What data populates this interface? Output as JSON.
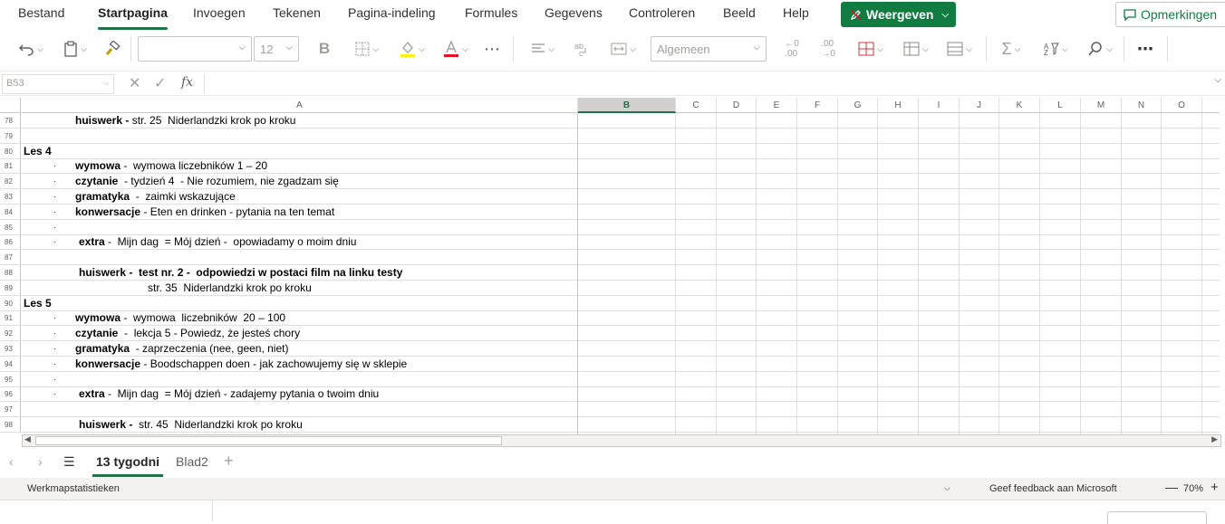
{
  "ribbon": {
    "tabs": [
      "Bestand",
      "Startpagina",
      "Invoegen",
      "Tekenen",
      "Pagina-indeling",
      "Formules",
      "Gegevens",
      "Controleren",
      "Beeld",
      "Help"
    ],
    "view_button": "Weergeven",
    "comments_button": "Opmerkingen"
  },
  "toolbar": {
    "font_size": "12",
    "number_format": "Algemeen",
    "icons": [
      "undo-icon",
      "paste-icon",
      "format-painter-icon",
      "bold-icon",
      "borders-icon",
      "fill-color-icon",
      "font-color-icon",
      "more-icon",
      "align-icon",
      "wrap-text-icon",
      "merge-icon",
      "decrease-decimal-icon",
      "increase-decimal-icon",
      "insert-cells-icon",
      "format-table-icon",
      "cell-styles-icon",
      "autosum-icon",
      "sort-filter-icon",
      "find-icon",
      "more-options-icon"
    ]
  },
  "formula_bar": {
    "name_box": "B53",
    "fx_label": "fx"
  },
  "grid": {
    "columns": [
      "A",
      "B",
      "C",
      "D",
      "E",
      "F",
      "G",
      "H",
      "I",
      "J",
      "K",
      "L",
      "M",
      "N",
      "O"
    ],
    "selected_column": "B",
    "rows": [
      {
        "n": "78",
        "bold": "huiswerk - ",
        "text": "str. 25  Niderlandzki krok po kroku",
        "bullet": false,
        "indent": 59
      },
      {
        "n": "79",
        "bold": "",
        "text": "",
        "bullet": false,
        "indent": 0
      },
      {
        "n": "80",
        "bold": "Les 4",
        "text": "",
        "bullet": false,
        "indent": 2
      },
      {
        "n": "81",
        "bold": "wymowa",
        "text": " -  wymowa liczebników 1 – 20",
        "bullet": true,
        "indent": 59
      },
      {
        "n": "82",
        "bold": "czytanie",
        "text": "  - tydzień 4  - Nie rozumiem, nie zgadzam się",
        "bullet": true,
        "indent": 59
      },
      {
        "n": "83",
        "bold": "gramatyka",
        "text": "  -  zaimki wskazujące",
        "bullet": true,
        "indent": 59
      },
      {
        "n": "84",
        "bold": "konwersacje",
        "text": " - Eten en drinken - pytania na ten temat",
        "bullet": true,
        "indent": 59
      },
      {
        "n": "85",
        "bold": "",
        "text": "",
        "bullet": true,
        "indent": 59
      },
      {
        "n": "86",
        "bold": "extra",
        "text": " -  Mijn dag  = Mój dzień -  opowiadamy o moim dniu",
        "bullet": true,
        "indent": 63
      },
      {
        "n": "87",
        "bold": "",
        "text": "",
        "bullet": false,
        "indent": 0
      },
      {
        "n": "88",
        "bold": "huiswerk -  test nr. 2 -  odpowiedzi w postaci film na linku testy",
        "text": "",
        "bullet": false,
        "indent": 63
      },
      {
        "n": "89",
        "bold": "",
        "text": "str. 35  Niderlandzki krok po kroku",
        "bullet": false,
        "indent": 139
      },
      {
        "n": "90",
        "bold": "Les 5",
        "text": "",
        "bullet": false,
        "indent": 2
      },
      {
        "n": "91",
        "bold": "wymowa",
        "text": " -  wymowa  liczebników  20 – 100",
        "bullet": true,
        "indent": 59
      },
      {
        "n": "92",
        "bold": "czytanie",
        "text": "  -  lekcja 5 - Powiedz, że jesteś chory",
        "bullet": true,
        "indent": 59
      },
      {
        "n": "93",
        "bold": "gramatyka",
        "text": "  - zaprzeczenia (nee, geen, niet)",
        "bullet": true,
        "indent": 59
      },
      {
        "n": "94",
        "bold": "konwersacje",
        "text": " - Boodschappen doen - jak zachowujemy się w sklepie",
        "bullet": true,
        "indent": 59
      },
      {
        "n": "95",
        "bold": "",
        "text": "",
        "bullet": true,
        "indent": 59
      },
      {
        "n": "96",
        "bold": "extra",
        "text": " -  Mijn dag  = Mój dzień - zadajemy pytania o twoim dniu",
        "bullet": true,
        "indent": 63
      },
      {
        "n": "97",
        "bold": "",
        "text": "",
        "bullet": false,
        "indent": 0
      },
      {
        "n": "98",
        "bold": "huiswerk -  ",
        "text": "str. 45  Niderlandzki krok po kroku",
        "bullet": false,
        "indent": 63
      }
    ]
  },
  "sheets": {
    "tabs": [
      "13 tygodni",
      "Blad2"
    ],
    "active": "13 tygodni"
  },
  "statusbar": {
    "stats": "Werkmapstatistieken",
    "feedback": "Geef feedback aan Microsoft",
    "zoom": "70%"
  }
}
